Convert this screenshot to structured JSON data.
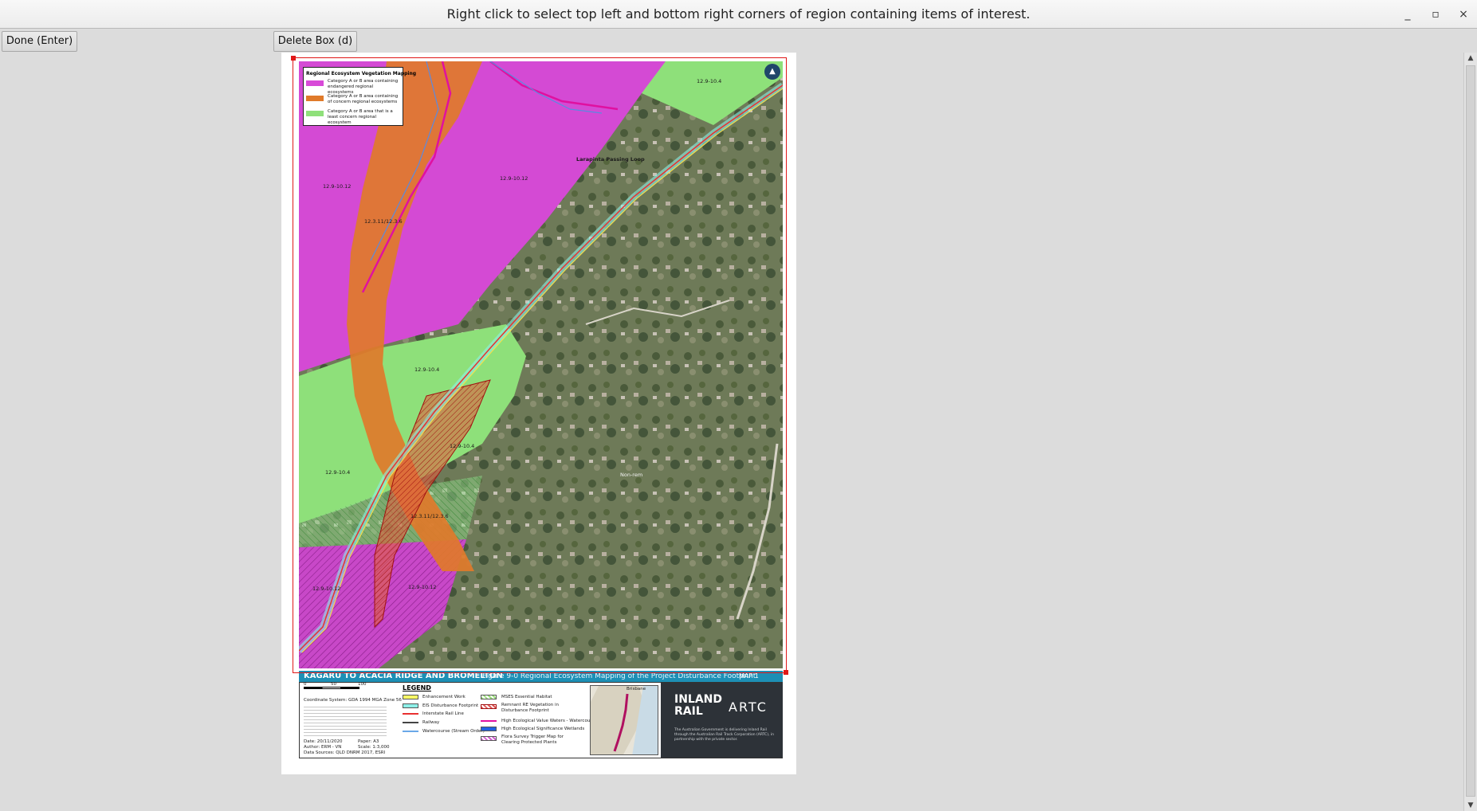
{
  "window": {
    "title": "Right click to select top left and bottom right corners of region containing items of interest.",
    "minimize": "_",
    "maximize": "▫",
    "close": "×"
  },
  "toolbar": {
    "done_label": "Done (Enter)",
    "delete_label": "Delete Box (d)"
  },
  "scrollbar": {
    "up": "▲",
    "down": "▼"
  },
  "map": {
    "eco_legend": {
      "title": "Regional Ecosystem Vegetation Mapping",
      "items": [
        {
          "label": "Category A or B area containing endangered regional ecosystems",
          "color": "#d84ad8"
        },
        {
          "label": "Category A or B area containing of concern regional ecosystems",
          "color": "#e07a2a"
        },
        {
          "label": "Category A or B area that is a least concern regional ecosystem",
          "color": "#8fe07a"
        }
      ]
    },
    "north_arrow": "▲",
    "labels": {
      "re_12_9_10_4_top": "12.9-10.4",
      "re_12_9_10_12_left": "12.9-10.12",
      "re_12_3_11_12_3_6": "12.3.11/12.3.6",
      "re_12_9_10_12_center": "12.9-10.12",
      "passing_loop": "Larapinta Passing Loop",
      "re_12_9_10_4_mid": "12.9-10.4",
      "re_12_9_10_4_right": "12.9-10.4",
      "re_12_9_10_4_lower_left": "12.9-10.4",
      "re_12_3_11_12_3_6_lower": "12.3.11/12.3.6",
      "re_12_9_10_12_bottom_left": "12.9-10.12",
      "re_12_9_10_12_bottom_mid": "12.9-10.12",
      "non_remnant": "Non-rem"
    },
    "title_strip": {
      "main": "KAGARU TO ACACIA RIDGE AND BROMELTON",
      "sub": "Figure 9-0 Regional Ecosystem Mapping of the Project Disturbance Footprint",
      "map_no": "MAP 1"
    },
    "legend": {
      "title": "LEGEND",
      "col1": [
        {
          "label": "Enhancement Work",
          "color": "#ffff66"
        },
        {
          "label": "EIS Disturbance Footprint",
          "color": "#8ef0e8"
        },
        {
          "label": "Interstate Rail Line",
          "color": "#e83030"
        },
        {
          "label": "Railway",
          "color": "#444444"
        },
        {
          "label": "Watercourse (Stream Order)",
          "color": "#6aa8e8"
        }
      ],
      "col2": [
        {
          "label": "MSES Essential Habitat",
          "color": "#9ae07a"
        },
        {
          "label": "Remnant RE Vegetation in Disturbance Footprint",
          "color": "#e05a5a"
        },
        {
          "label": "High Ecological Value Waters - Watercourse",
          "color": "#e010a0"
        },
        {
          "label": "High Ecological Significance Wetlands",
          "color": "#2060e0"
        },
        {
          "label": "Flora Survey Trigger Map for Clearing Protected Plants",
          "color": "#d060d0"
        }
      ]
    },
    "scale": {
      "ticks": [
        "0",
        "50",
        "100"
      ]
    },
    "coordinate_system": "Coordinate System:  GDA 1994 MGA Zone 56",
    "meta": {
      "date": "Date: 20/11/2020",
      "author": "Author: ERM - VN",
      "sources": "Data Sources: QLD DNRM 2017, ESRI",
      "paper": "Paper: A3",
      "scale": "Scale: 1:3,000"
    },
    "logo": {
      "inland": "INLAND",
      "rail": "RAIL",
      "artc": "ARTC",
      "note": "The Australian Government is delivering Inland Rail through the Australian Rail Track Corporation (ARTC), in partnership with the private sector."
    },
    "inset_label": "Brisbane"
  }
}
